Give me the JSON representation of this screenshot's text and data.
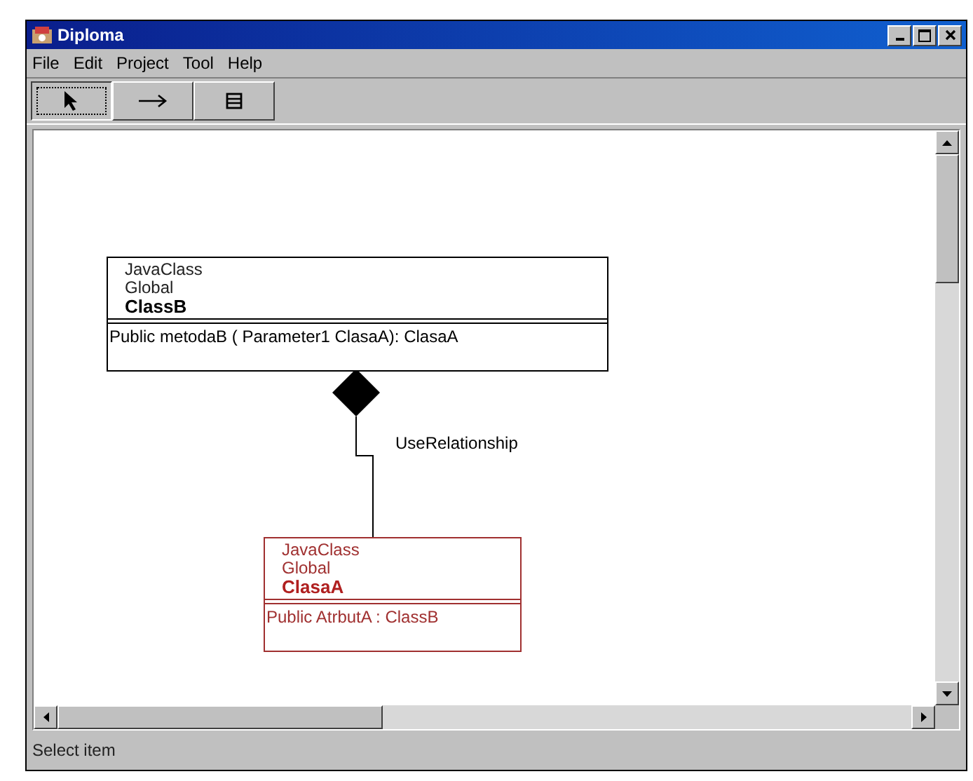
{
  "window": {
    "title": "Diploma"
  },
  "menu": [
    "File",
    "Edit",
    "Project",
    "Tool",
    "Help"
  ],
  "toolbar": [
    {
      "kind": "select",
      "selected": true
    },
    {
      "kind": "relation",
      "selected": false
    },
    {
      "kind": "class",
      "selected": false
    }
  ],
  "classes": [
    {
      "stereotype": "JavaClass",
      "scope": "Global",
      "name": "ClassB",
      "members": [
        "Public metodaB (  Parameter1 ClasaA): ClasaA"
      ],
      "selected": false
    },
    {
      "stereotype": "JavaClass",
      "scope": "Global",
      "name": "ClasaA",
      "members": [
        "Public AtrbutA : ClassB"
      ],
      "selected": true
    }
  ],
  "relationship": {
    "label": "UseRelationship"
  },
  "status_bar": "Select item"
}
